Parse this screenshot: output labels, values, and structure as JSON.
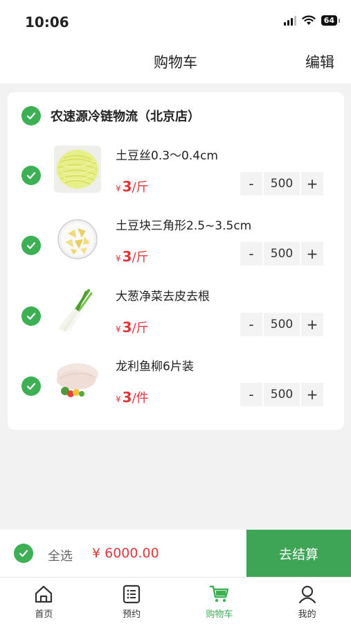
{
  "status_bar": {
    "time": "10:06",
    "battery": "64"
  },
  "header": {
    "title": "购物车",
    "edit_label": "编辑"
  },
  "store": {
    "name": "农速源冷链物流（北京店）",
    "selected": true
  },
  "items": [
    {
      "name": "土豆丝0.3～0.4cm",
      "currency": "¥",
      "price": "3",
      "unit": "/斤",
      "quantity": "500",
      "minus": "-",
      "plus": "+",
      "selected": true,
      "image": "shredded-potato-image"
    },
    {
      "name": "土豆块三角形2.5~3.5cm",
      "currency": "¥",
      "price": "3",
      "unit": "/斤",
      "quantity": "500",
      "minus": "-",
      "plus": "+",
      "selected": true,
      "image": "potato-chunks-image"
    },
    {
      "name": "大葱净菜去皮去根",
      "currency": "¥",
      "price": "3",
      "unit": "/斤",
      "quantity": "500",
      "minus": "-",
      "plus": "+",
      "selected": true,
      "image": "green-onion-image"
    },
    {
      "name": "龙利鱼柳6片装",
      "currency": "¥",
      "price": "3",
      "unit": "/件",
      "quantity": "500",
      "minus": "-",
      "plus": "+",
      "selected": true,
      "image": "fish-fillet-image"
    }
  ],
  "checkout": {
    "select_all_label": "全选",
    "total": "¥ 6000.00",
    "button_label": "去结算"
  },
  "tabs": [
    {
      "label": "首页",
      "icon": "home-icon",
      "active": false
    },
    {
      "label": "预约",
      "icon": "list-icon",
      "active": false
    },
    {
      "label": "购物车",
      "icon": "cart-icon",
      "active": true
    },
    {
      "label": "我的",
      "icon": "user-icon",
      "active": false
    }
  ],
  "colors": {
    "accent": "#3daf55",
    "checkout_button": "#3da555",
    "price": "#e0373a",
    "background": "#f2f2f2"
  }
}
